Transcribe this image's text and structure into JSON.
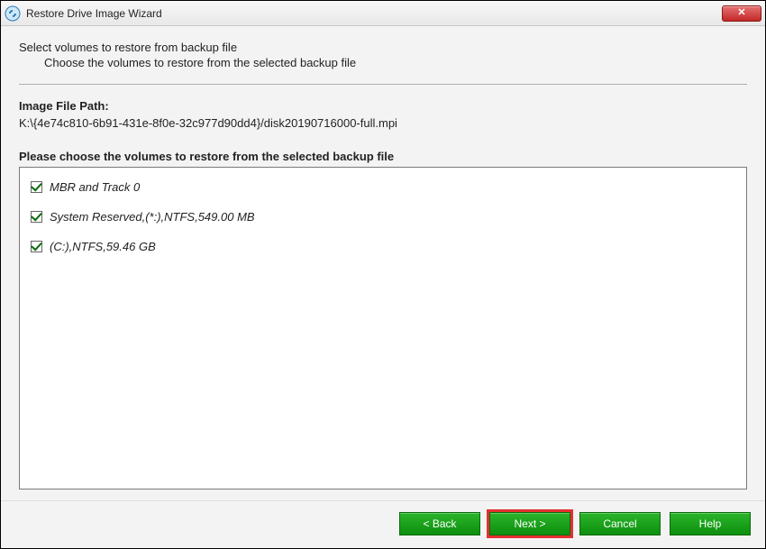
{
  "window": {
    "title": "Restore Drive Image Wizard"
  },
  "header": {
    "title": "Select volumes to restore from backup file",
    "subtitle": "Choose the volumes to restore from the selected backup file"
  },
  "image_path": {
    "label": "Image File Path:",
    "value": "K:\\{4e74c810-6b91-431e-8f0e-32c977d90dd4}/disk20190716000-full.mpi"
  },
  "volumes": {
    "label": "Please choose the volumes to restore from the selected backup file",
    "items": [
      {
        "label": "MBR and Track 0",
        "checked": true
      },
      {
        "label": "System Reserved,(*:),NTFS,549.00 MB",
        "checked": true
      },
      {
        "label": "(C:),NTFS,59.46 GB",
        "checked": true
      }
    ]
  },
  "buttons": {
    "back": "< Back",
    "next": "Next >",
    "cancel": "Cancel",
    "help": "Help"
  }
}
